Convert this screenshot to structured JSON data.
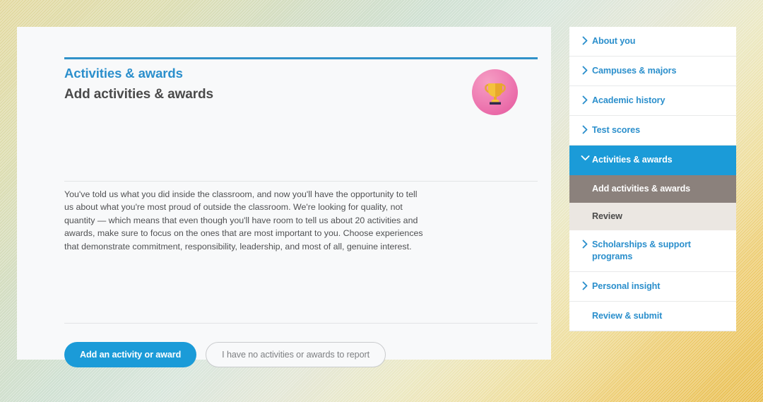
{
  "theme": {
    "accent_blue": "#1b9bd8",
    "title_blue": "#2b8fcc",
    "current_subitem_bg": "#8b817c",
    "plain_subitem_bg": "#ebe7e2",
    "badge_pink": "#ef7fb4",
    "card_bg": "#f8f9fa"
  },
  "main": {
    "eyebrow": "Activities & awards",
    "heading": "Add activities & awards",
    "badge_icon": "trophy-icon",
    "body": "You've told us what you did inside the classroom, and now you'll have the opportunity to tell us about what you're most proud of outside the classroom. We're looking for quality, not quantity — which means that even though you'll have room to tell us about 20 activities and awards, make sure to focus on the ones that are most important to you. Choose experiences that demonstrate commitment, responsibility, leadership, and most of all, genuine interest.",
    "primary_button": "Add an activity or award",
    "secondary_button": "I have no activities or awards to report"
  },
  "sidebar": {
    "items": [
      {
        "label": "About you",
        "icon": "chevron-right-icon",
        "state": "collapsed"
      },
      {
        "label": "Campuses & majors",
        "icon": "chevron-right-icon",
        "state": "collapsed"
      },
      {
        "label": "Academic history",
        "icon": "chevron-right-icon",
        "state": "collapsed"
      },
      {
        "label": "Test scores",
        "icon": "chevron-right-icon",
        "state": "collapsed"
      },
      {
        "label": "Activities & awards",
        "icon": "chevron-down-icon",
        "state": "expanded"
      }
    ],
    "sub_items": [
      {
        "label": "Add activities & awards",
        "state": "current"
      },
      {
        "label": "Review",
        "state": "default"
      }
    ],
    "items_after": [
      {
        "label": "Scholarships & support programs",
        "icon": "chevron-right-icon",
        "state": "collapsed"
      },
      {
        "label": "Personal insight",
        "icon": "chevron-right-icon",
        "state": "collapsed"
      },
      {
        "label": "Review & submit",
        "icon": "none",
        "state": "collapsed"
      }
    ]
  }
}
